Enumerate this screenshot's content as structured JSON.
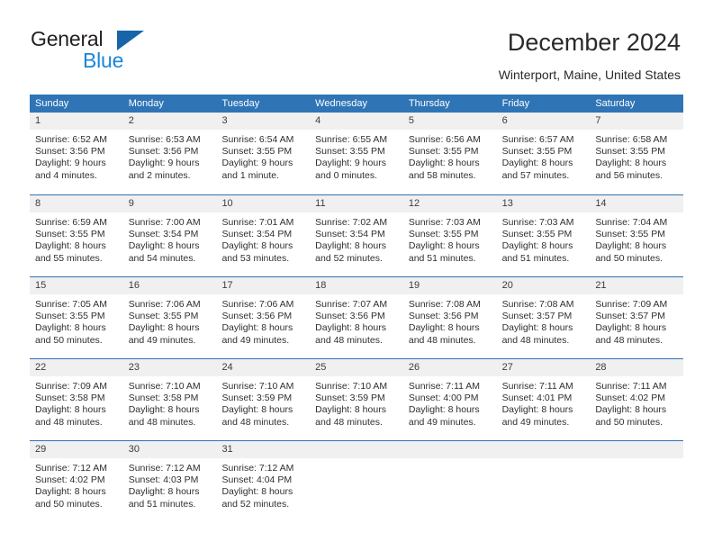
{
  "brand": {
    "name_part1": "General",
    "name_part2": "Blue",
    "triangle_color": "#1565a8",
    "blue_color": "#1a86d8"
  },
  "header": {
    "title": "December 2024",
    "location": "Winterport, Maine, United States"
  },
  "theme": {
    "header_row_bg": "#2f74b5",
    "header_row_text": "#ffffff",
    "daynum_bg": "#f0f0f0",
    "cell_bg": "#ffffff",
    "divider": "#2f74b5"
  },
  "weekdays": [
    "Sunday",
    "Monday",
    "Tuesday",
    "Wednesday",
    "Thursday",
    "Friday",
    "Saturday"
  ],
  "weeks": [
    [
      {
        "day": "1",
        "sunrise": "Sunrise: 6:52 AM",
        "sunset": "Sunset: 3:56 PM",
        "daylight1": "Daylight: 9 hours",
        "daylight2": "and 4 minutes."
      },
      {
        "day": "2",
        "sunrise": "Sunrise: 6:53 AM",
        "sunset": "Sunset: 3:56 PM",
        "daylight1": "Daylight: 9 hours",
        "daylight2": "and 2 minutes."
      },
      {
        "day": "3",
        "sunrise": "Sunrise: 6:54 AM",
        "sunset": "Sunset: 3:55 PM",
        "daylight1": "Daylight: 9 hours",
        "daylight2": "and 1 minute."
      },
      {
        "day": "4",
        "sunrise": "Sunrise: 6:55 AM",
        "sunset": "Sunset: 3:55 PM",
        "daylight1": "Daylight: 9 hours",
        "daylight2": "and 0 minutes."
      },
      {
        "day": "5",
        "sunrise": "Sunrise: 6:56 AM",
        "sunset": "Sunset: 3:55 PM",
        "daylight1": "Daylight: 8 hours",
        "daylight2": "and 58 minutes."
      },
      {
        "day": "6",
        "sunrise": "Sunrise: 6:57 AM",
        "sunset": "Sunset: 3:55 PM",
        "daylight1": "Daylight: 8 hours",
        "daylight2": "and 57 minutes."
      },
      {
        "day": "7",
        "sunrise": "Sunrise: 6:58 AM",
        "sunset": "Sunset: 3:55 PM",
        "daylight1": "Daylight: 8 hours",
        "daylight2": "and 56 minutes."
      }
    ],
    [
      {
        "day": "8",
        "sunrise": "Sunrise: 6:59 AM",
        "sunset": "Sunset: 3:55 PM",
        "daylight1": "Daylight: 8 hours",
        "daylight2": "and 55 minutes."
      },
      {
        "day": "9",
        "sunrise": "Sunrise: 7:00 AM",
        "sunset": "Sunset: 3:54 PM",
        "daylight1": "Daylight: 8 hours",
        "daylight2": "and 54 minutes."
      },
      {
        "day": "10",
        "sunrise": "Sunrise: 7:01 AM",
        "sunset": "Sunset: 3:54 PM",
        "daylight1": "Daylight: 8 hours",
        "daylight2": "and 53 minutes."
      },
      {
        "day": "11",
        "sunrise": "Sunrise: 7:02 AM",
        "sunset": "Sunset: 3:54 PM",
        "daylight1": "Daylight: 8 hours",
        "daylight2": "and 52 minutes."
      },
      {
        "day": "12",
        "sunrise": "Sunrise: 7:03 AM",
        "sunset": "Sunset: 3:55 PM",
        "daylight1": "Daylight: 8 hours",
        "daylight2": "and 51 minutes."
      },
      {
        "day": "13",
        "sunrise": "Sunrise: 7:03 AM",
        "sunset": "Sunset: 3:55 PM",
        "daylight1": "Daylight: 8 hours",
        "daylight2": "and 51 minutes."
      },
      {
        "day": "14",
        "sunrise": "Sunrise: 7:04 AM",
        "sunset": "Sunset: 3:55 PM",
        "daylight1": "Daylight: 8 hours",
        "daylight2": "and 50 minutes."
      }
    ],
    [
      {
        "day": "15",
        "sunrise": "Sunrise: 7:05 AM",
        "sunset": "Sunset: 3:55 PM",
        "daylight1": "Daylight: 8 hours",
        "daylight2": "and 50 minutes."
      },
      {
        "day": "16",
        "sunrise": "Sunrise: 7:06 AM",
        "sunset": "Sunset: 3:55 PM",
        "daylight1": "Daylight: 8 hours",
        "daylight2": "and 49 minutes."
      },
      {
        "day": "17",
        "sunrise": "Sunrise: 7:06 AM",
        "sunset": "Sunset: 3:56 PM",
        "daylight1": "Daylight: 8 hours",
        "daylight2": "and 49 minutes."
      },
      {
        "day": "18",
        "sunrise": "Sunrise: 7:07 AM",
        "sunset": "Sunset: 3:56 PM",
        "daylight1": "Daylight: 8 hours",
        "daylight2": "and 48 minutes."
      },
      {
        "day": "19",
        "sunrise": "Sunrise: 7:08 AM",
        "sunset": "Sunset: 3:56 PM",
        "daylight1": "Daylight: 8 hours",
        "daylight2": "and 48 minutes."
      },
      {
        "day": "20",
        "sunrise": "Sunrise: 7:08 AM",
        "sunset": "Sunset: 3:57 PM",
        "daylight1": "Daylight: 8 hours",
        "daylight2": "and 48 minutes."
      },
      {
        "day": "21",
        "sunrise": "Sunrise: 7:09 AM",
        "sunset": "Sunset: 3:57 PM",
        "daylight1": "Daylight: 8 hours",
        "daylight2": "and 48 minutes."
      }
    ],
    [
      {
        "day": "22",
        "sunrise": "Sunrise: 7:09 AM",
        "sunset": "Sunset: 3:58 PM",
        "daylight1": "Daylight: 8 hours",
        "daylight2": "and 48 minutes."
      },
      {
        "day": "23",
        "sunrise": "Sunrise: 7:10 AM",
        "sunset": "Sunset: 3:58 PM",
        "daylight1": "Daylight: 8 hours",
        "daylight2": "and 48 minutes."
      },
      {
        "day": "24",
        "sunrise": "Sunrise: 7:10 AM",
        "sunset": "Sunset: 3:59 PM",
        "daylight1": "Daylight: 8 hours",
        "daylight2": "and 48 minutes."
      },
      {
        "day": "25",
        "sunrise": "Sunrise: 7:10 AM",
        "sunset": "Sunset: 3:59 PM",
        "daylight1": "Daylight: 8 hours",
        "daylight2": "and 48 minutes."
      },
      {
        "day": "26",
        "sunrise": "Sunrise: 7:11 AM",
        "sunset": "Sunset: 4:00 PM",
        "daylight1": "Daylight: 8 hours",
        "daylight2": "and 49 minutes."
      },
      {
        "day": "27",
        "sunrise": "Sunrise: 7:11 AM",
        "sunset": "Sunset: 4:01 PM",
        "daylight1": "Daylight: 8 hours",
        "daylight2": "and 49 minutes."
      },
      {
        "day": "28",
        "sunrise": "Sunrise: 7:11 AM",
        "sunset": "Sunset: 4:02 PM",
        "daylight1": "Daylight: 8 hours",
        "daylight2": "and 50 minutes."
      }
    ],
    [
      {
        "day": "29",
        "sunrise": "Sunrise: 7:12 AM",
        "sunset": "Sunset: 4:02 PM",
        "daylight1": "Daylight: 8 hours",
        "daylight2": "and 50 minutes."
      },
      {
        "day": "30",
        "sunrise": "Sunrise: 7:12 AM",
        "sunset": "Sunset: 4:03 PM",
        "daylight1": "Daylight: 8 hours",
        "daylight2": "and 51 minutes."
      },
      {
        "day": "31",
        "sunrise": "Sunrise: 7:12 AM",
        "sunset": "Sunset: 4:04 PM",
        "daylight1": "Daylight: 8 hours",
        "daylight2": "and 52 minutes."
      },
      {
        "day": "",
        "sunrise": "",
        "sunset": "",
        "daylight1": "",
        "daylight2": ""
      },
      {
        "day": "",
        "sunrise": "",
        "sunset": "",
        "daylight1": "",
        "daylight2": ""
      },
      {
        "day": "",
        "sunrise": "",
        "sunset": "",
        "daylight1": "",
        "daylight2": ""
      },
      {
        "day": "",
        "sunrise": "",
        "sunset": "",
        "daylight1": "",
        "daylight2": ""
      }
    ]
  ]
}
